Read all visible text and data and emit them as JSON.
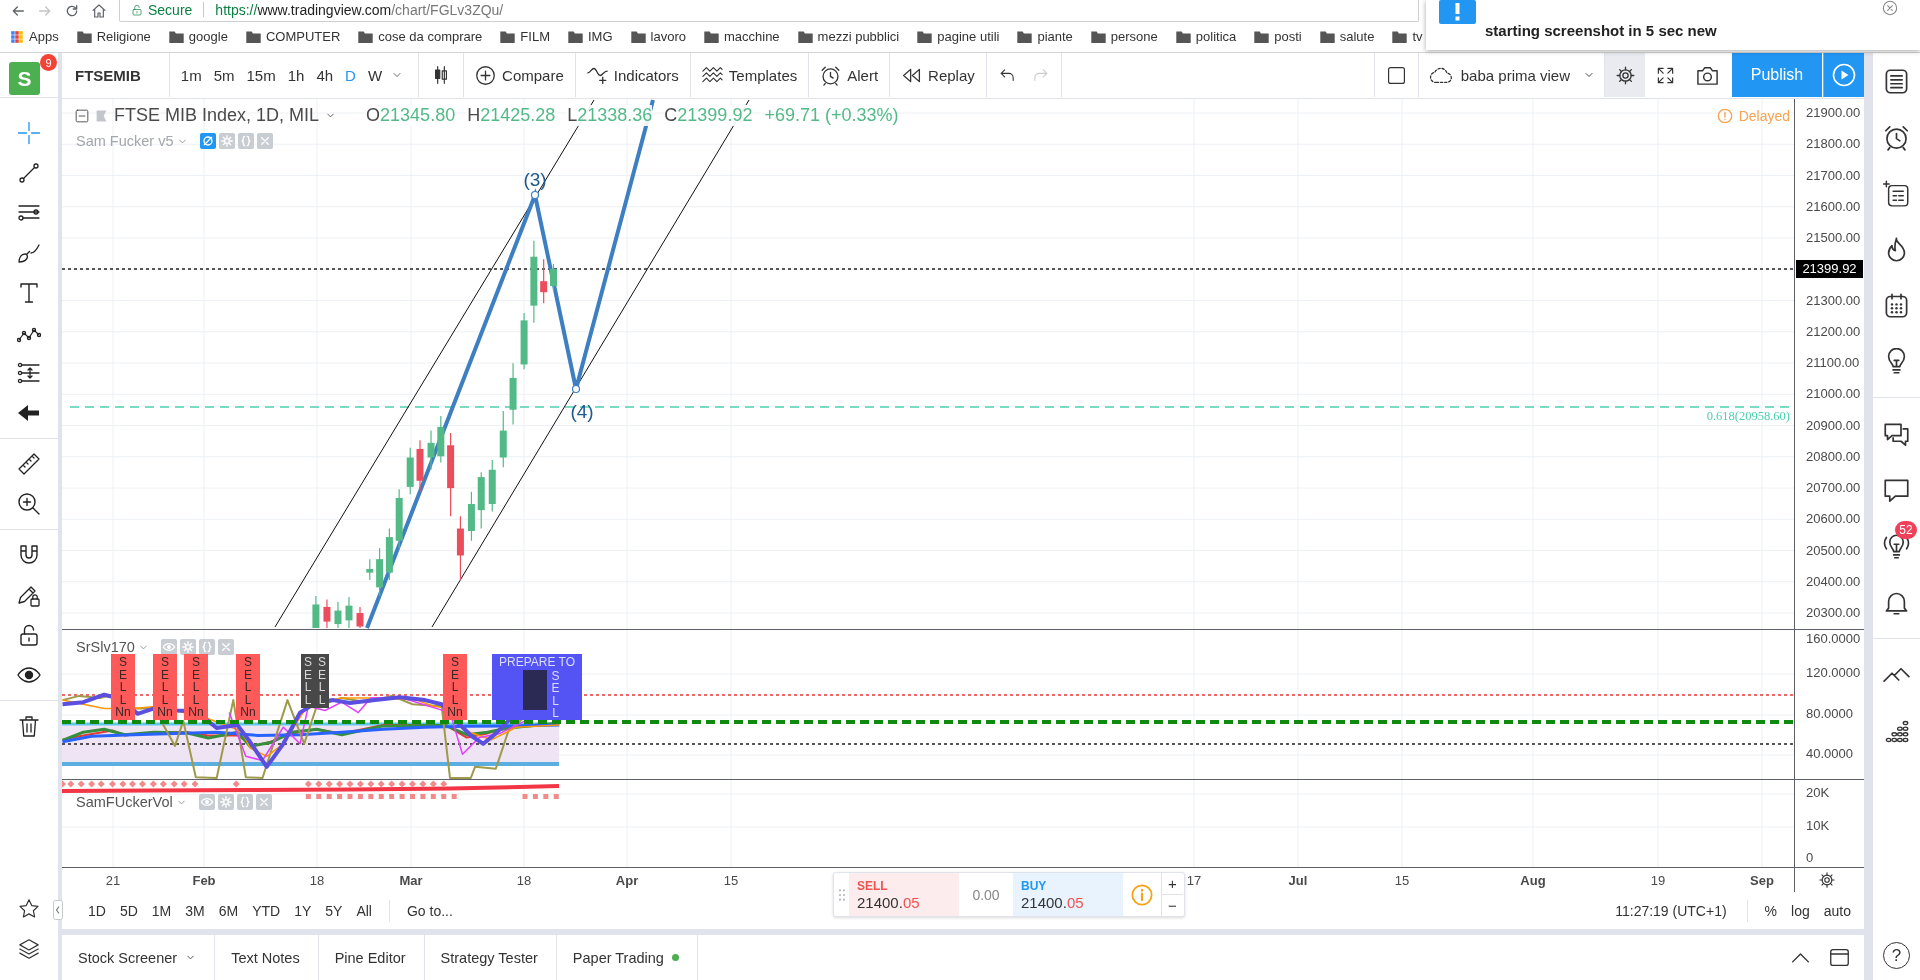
{
  "browser": {
    "security_label": "Secure",
    "url": {
      "scheme": "https://",
      "host": "www.tradingview.com",
      "path": "/chart/FGLv3ZQu/"
    }
  },
  "bookmarks": [
    {
      "kind": "apps",
      "label": "Apps"
    },
    {
      "kind": "folder",
      "label": "Religione"
    },
    {
      "kind": "folder",
      "label": "google"
    },
    {
      "kind": "folder",
      "label": "COMPUTER"
    },
    {
      "kind": "folder",
      "label": "cose da comprare"
    },
    {
      "kind": "folder",
      "label": "FILM"
    },
    {
      "kind": "folder",
      "label": "IMG"
    },
    {
      "kind": "folder",
      "label": "lavoro"
    },
    {
      "kind": "folder",
      "label": "macchine"
    },
    {
      "kind": "folder",
      "label": "mezzi pubblici"
    },
    {
      "kind": "folder",
      "label": "pagine utili"
    },
    {
      "kind": "folder",
      "label": "piante"
    },
    {
      "kind": "folder",
      "label": "persone"
    },
    {
      "kind": "folder",
      "label": "politica"
    },
    {
      "kind": "folder",
      "label": "posti"
    },
    {
      "kind": "folder",
      "label": "salute"
    },
    {
      "kind": "folder",
      "label": "tv"
    }
  ],
  "notification": {
    "text": "starting screenshot in 5 sec new"
  },
  "user": {
    "initial": "S",
    "badge": "9"
  },
  "toolbar": {
    "symbol": "FTSEMIB",
    "intervals": [
      {
        "label": "1m",
        "selected": false
      },
      {
        "label": "5m",
        "selected": false
      },
      {
        "label": "15m",
        "selected": false
      },
      {
        "label": "1h",
        "selected": false
      },
      {
        "label": "4h",
        "selected": false
      },
      {
        "label": "D",
        "selected": true
      },
      {
        "label": "W",
        "selected": false
      }
    ],
    "actions": [
      {
        "kind": "compare",
        "label": "Compare"
      },
      {
        "kind": "indicators",
        "label": "Indicators"
      },
      {
        "kind": "templates",
        "label": "Templates"
      },
      {
        "kind": "alert",
        "label": "Alert"
      },
      {
        "kind": "replay",
        "label": "Replay"
      }
    ],
    "undo": {
      "disabled": false
    },
    "redo": {
      "disabled": true
    },
    "layout_name": "baba prima view",
    "settings": {
      "hovered": true
    },
    "publish": "Publish"
  },
  "drawing_tools": [
    {
      "tools": [
        {
          "kind": "crosshair",
          "selected": true
        },
        {
          "kind": "trend_line",
          "selected": false
        },
        {
          "kind": "parallel_lines",
          "selected": false
        },
        {
          "kind": "brush",
          "selected": false
        },
        {
          "kind": "text",
          "selected": false
        },
        {
          "kind": "pattern",
          "selected": false
        },
        {
          "kind": "prediction",
          "selected": false
        },
        {
          "kind": "arrow",
          "selected": false
        }
      ]
    },
    {
      "tools": [
        {
          "kind": "ruler",
          "selected": false
        },
        {
          "kind": "zoom",
          "selected": false
        }
      ]
    },
    {
      "tools": [
        {
          "kind": "magnet",
          "selected": false
        },
        {
          "kind": "pencil_lock",
          "selected": false
        },
        {
          "kind": "lock",
          "selected": false
        },
        {
          "kind": "eye",
          "selected": false
        }
      ]
    },
    {
      "tools": [
        {
          "kind": "trash",
          "selected": false
        }
      ]
    }
  ],
  "chart": {
    "title": "FTSE MIB Index, 1D, MIL",
    "ohlc": [
      {
        "key": "O",
        "value": "21345.80"
      },
      {
        "key": "H",
        "value": "21425.28"
      },
      {
        "key": "L",
        "value": "21338.36"
      },
      {
        "key": "C",
        "value": "21399.92"
      }
    ],
    "change": "+69.71 (+0.33%)",
    "delayed": "Delayed",
    "legend": {
      "name": "Sam Fucker v5",
      "hidden": true
    },
    "wave_labels": [
      "(3)",
      "(4)"
    ],
    "fib_label": "0.618(20958.60)",
    "price_axis": [
      {
        "label": "21900.00",
        "kind": "tick"
      },
      {
        "label": "21800.00",
        "kind": "tick"
      },
      {
        "label": "21700.00",
        "kind": "tick"
      },
      {
        "label": "21600.00",
        "kind": "tick"
      },
      {
        "label": "21500.00",
        "kind": "tick"
      },
      {
        "label": "21399.92",
        "kind": "last"
      },
      {
        "label": "21300.00",
        "kind": "tick"
      },
      {
        "label": "21200.00",
        "kind": "tick"
      },
      {
        "label": "21100.00",
        "kind": "tick"
      },
      {
        "label": "21000.00",
        "kind": "tick"
      },
      {
        "label": "20900.00",
        "kind": "tick"
      },
      {
        "label": "20800.00",
        "kind": "tick"
      },
      {
        "label": "20700.00",
        "kind": "tick"
      },
      {
        "label": "20600.00",
        "kind": "tick"
      },
      {
        "label": "20500.00",
        "kind": "tick"
      },
      {
        "label": "20400.00",
        "kind": "tick"
      },
      {
        "label": "20300.00",
        "kind": "tick"
      }
    ]
  },
  "oscillator_pane": {
    "legend": {
      "name": "SrSlv170",
      "hidden": false
    },
    "axis": [
      "160.0000",
      "120.0000",
      "80.0000",
      "40.0000"
    ],
    "signals": [
      {
        "kind": "sell",
        "text": "SELL",
        "note": "Nn"
      },
      {
        "kind": "sell",
        "text": "SELL",
        "note": "Nn"
      },
      {
        "kind": "sell",
        "text": "SELL",
        "note": "Nn"
      },
      {
        "kind": "sell",
        "text": "SELL",
        "note": "Nn"
      },
      {
        "kind": "dark",
        "text": "SELL"
      },
      {
        "kind": "dark",
        "text": "SELL"
      },
      {
        "kind": "sell",
        "text": "SELL",
        "note": "Nn"
      },
      {
        "kind": "prepare",
        "text": "SELL",
        "note": "PREPARE TO"
      }
    ]
  },
  "volume_pane": {
    "legend": {
      "name": "SamFUckerVol",
      "hidden": false
    },
    "axis": [
      "20K",
      "10K",
      "0"
    ]
  },
  "time_axis": [
    {
      "label": "21",
      "kind": "day"
    },
    {
      "label": "Feb",
      "kind": "month"
    },
    {
      "label": "18",
      "kind": "day"
    },
    {
      "label": "Mar",
      "kind": "month"
    },
    {
      "label": "18",
      "kind": "day"
    },
    {
      "label": "Apr",
      "kind": "month"
    },
    {
      "label": "15",
      "kind": "day"
    },
    {
      "label": "17",
      "kind": "day"
    },
    {
      "label": "Jul",
      "kind": "month"
    },
    {
      "label": "15",
      "kind": "day"
    },
    {
      "label": "Aug",
      "kind": "month"
    },
    {
      "label": "19",
      "kind": "day"
    },
    {
      "label": "Sep",
      "kind": "month"
    }
  ],
  "trade": {
    "sell": {
      "label": "SELL",
      "price": "21400.",
      "pips": "05"
    },
    "spread": "0.00",
    "buy": {
      "label": "BUY",
      "price": "21400.",
      "pips": "05"
    },
    "plus": "+",
    "minus": "−"
  },
  "range_bar": {
    "ranges": [
      "1D",
      "5D",
      "1M",
      "3M",
      "6M",
      "YTD",
      "1Y",
      "5Y",
      "All"
    ],
    "goto": "Go to...",
    "clock": "11:27:19 (UTC+1)",
    "scale": [
      "%",
      "log",
      "auto"
    ]
  },
  "bottom_tabs": [
    {
      "label": "Stock Screener",
      "kind": "dropdown"
    },
    {
      "label": "Text Notes",
      "kind": "plain"
    },
    {
      "label": "Pine Editor",
      "kind": "plain"
    },
    {
      "label": "Strategy Tester",
      "kind": "plain"
    },
    {
      "label": "Paper Trading",
      "kind": "status"
    }
  ],
  "right_sidebar": {
    "badge": "52",
    "help": "?"
  }
}
